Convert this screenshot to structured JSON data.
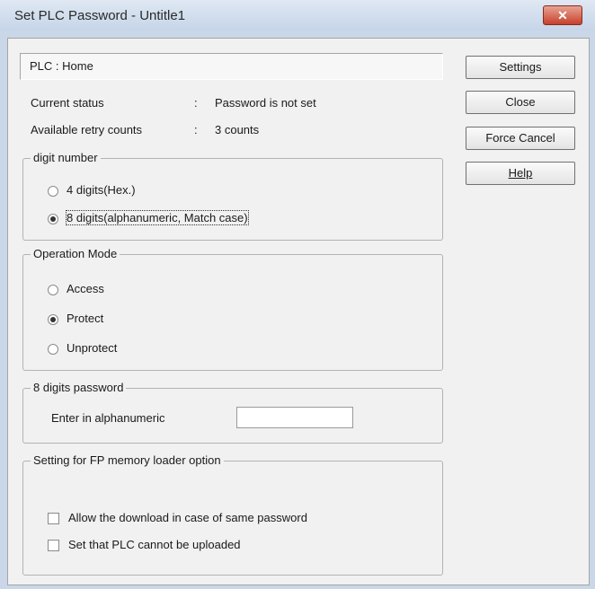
{
  "window": {
    "title": "Set PLC Password - Untitle1",
    "close_glyph": "✕"
  },
  "plc": {
    "label": "PLC  :  Home"
  },
  "status": {
    "current_label": "Current status",
    "current_sep": ":",
    "current_value": "Password is not set",
    "retry_label": "Available retry counts",
    "retry_sep": ":",
    "retry_value": "3 counts"
  },
  "buttons": {
    "settings": "Settings",
    "close": "Close",
    "force_cancel": "Force Cancel",
    "help": "Help"
  },
  "digit_group": {
    "legend": "digit number",
    "option_4": "4 digits(Hex.)",
    "option_8": "8 digits(alphanumeric, Match case)",
    "selected": "8 digits"
  },
  "mode_group": {
    "legend": "Operation Mode",
    "access": "Access",
    "protect": "Protect",
    "unprotect": "Unprotect",
    "selected": "Protect"
  },
  "password_group": {
    "legend": "8 digits password",
    "enter_label": "Enter in alphanumeric",
    "value": ""
  },
  "fp_group": {
    "legend": "Setting for FP memory loader option",
    "allow_download": "Allow the download in case of same password",
    "cannot_upload": "Set that PLC cannot be uploaded"
  }
}
